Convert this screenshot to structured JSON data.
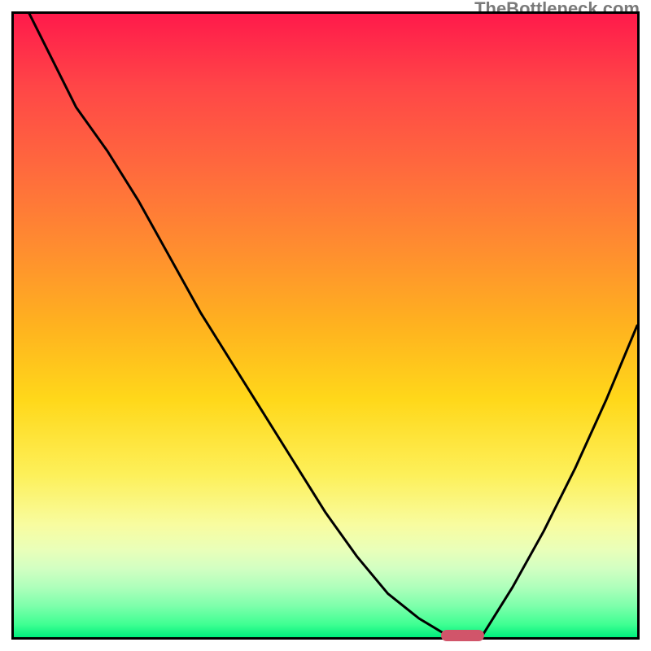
{
  "watermark": "TheBottleneck.com",
  "colors": {
    "frame_border": "#000000",
    "curve": "#000000",
    "marker": "#d1556a",
    "gradient_top": "#ff1a4b",
    "gradient_bottom": "#00ef7d"
  },
  "chart_data": {
    "type": "line",
    "title": "",
    "xlabel": "",
    "ylabel": "",
    "xlim": [
      0,
      100
    ],
    "ylim": [
      0,
      100
    ],
    "x": [
      0,
      5,
      10,
      15,
      20,
      25,
      30,
      35,
      40,
      45,
      50,
      55,
      60,
      65,
      70,
      72,
      75,
      80,
      85,
      90,
      95,
      100
    ],
    "y": [
      105,
      95,
      85,
      78,
      70,
      61,
      52,
      44,
      36,
      28,
      20,
      13,
      7,
      3,
      0,
      0,
      0,
      8,
      17,
      27,
      38,
      50
    ],
    "note": "y is bottleneck-like percentage (0 = optimal). Curve drops from top-left to a flat minimum near x≈68–75 then rises toward the right.",
    "marker": {
      "x_center": 72,
      "width_x": 7,
      "y": 0
    }
  }
}
